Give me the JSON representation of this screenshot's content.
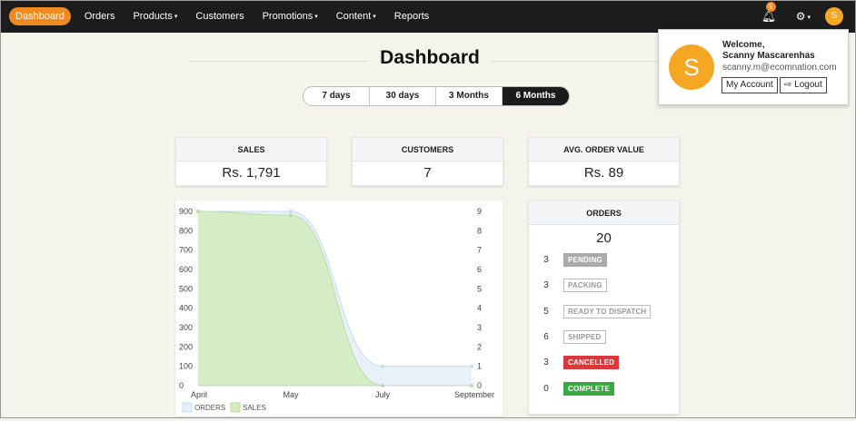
{
  "nav": {
    "items": [
      {
        "label": "Dashboard",
        "active": true,
        "caret": false
      },
      {
        "label": "Orders",
        "active": false,
        "caret": false
      },
      {
        "label": "Products",
        "active": false,
        "caret": true
      },
      {
        "label": "Customers",
        "active": false,
        "caret": false
      },
      {
        "label": "Promotions",
        "active": false,
        "caret": true
      },
      {
        "label": "Content",
        "active": false,
        "caret": true
      },
      {
        "label": "Reports",
        "active": false,
        "caret": false
      }
    ],
    "notifications_count": "5",
    "avatar_initial": "S",
    "bell_icon": "bell-icon",
    "gear_icon": "gear-icon"
  },
  "page": {
    "title": "Dashboard"
  },
  "ranges": [
    "7 days",
    "30 days",
    "3 Months",
    "6 Months"
  ],
  "active_range": "6 Months",
  "stats": {
    "sales": {
      "label": "SALES",
      "value": "Rs. 1,791"
    },
    "customers": {
      "label": "CUSTOMERS",
      "value": "7"
    },
    "avg_order": {
      "label": "AVG. ORDER VALUE",
      "value": "Rs. 89"
    }
  },
  "orders": {
    "title": "ORDERS",
    "total": "20",
    "rows": [
      {
        "count": "3",
        "status": "PENDING",
        "style": "filled-gray"
      },
      {
        "count": "3",
        "status": "PACKING",
        "style": "outline"
      },
      {
        "count": "5",
        "status": "READY TO DISPATCH",
        "style": "outline"
      },
      {
        "count": "6",
        "status": "SHIPPED",
        "style": "outline"
      },
      {
        "count": "3",
        "status": "CANCELLED",
        "style": "filled-red"
      },
      {
        "count": "0",
        "status": "COMPLETE",
        "style": "filled-green"
      }
    ]
  },
  "user_menu": {
    "avatar_initial": "S",
    "welcome": "Welcome,",
    "name": "Scanny Mascarenhas",
    "email": "scanny.m@ecomnation.com",
    "my_account_label": "My Account",
    "logout_label": "Logout"
  },
  "colors": {
    "accent": "#f08a21",
    "sales_fill": "#d4ecc4",
    "orders_fill": "#e6eff8"
  },
  "chart_data": {
    "type": "area",
    "categories": [
      "April",
      "May",
      "July",
      "September"
    ],
    "y_left_ticks": [
      0,
      100,
      200,
      300,
      400,
      500,
      600,
      700,
      800,
      900
    ],
    "y_right_ticks": [
      0,
      1,
      2,
      3,
      4,
      5,
      6,
      7,
      8,
      9
    ],
    "ylim_left": [
      0,
      900
    ],
    "ylim_right": [
      0,
      9
    ],
    "legend": "bottom-left",
    "grid": false,
    "series": [
      {
        "name": "ORDERS",
        "axis": "right",
        "values": [
          9,
          9,
          1,
          1
        ],
        "color": "#e6eff8"
      },
      {
        "name": "SALES",
        "axis": "left",
        "values": [
          900,
          880,
          0,
          0
        ],
        "color": "#d4ecc4"
      }
    ]
  }
}
